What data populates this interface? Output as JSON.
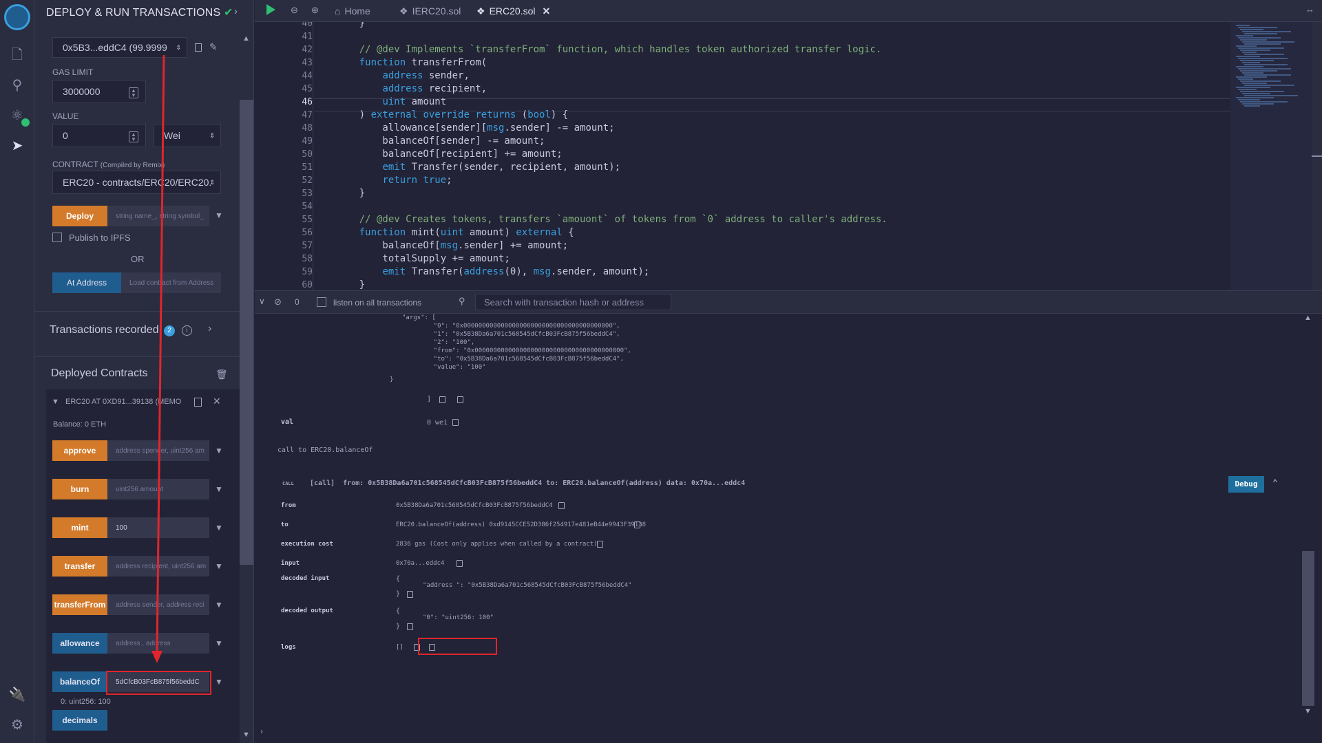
{
  "panel": {
    "title": "DEPLOY & RUN TRANSACTIONS",
    "account": "0x5B3...eddC4 (99.9999",
    "gas_limit_label": "GAS LIMIT",
    "gas_limit": "3000000",
    "value_label": "VALUE",
    "value": "0",
    "value_unit": "Wei",
    "contract_label": "CONTRACT",
    "contract_compiled_note": "(Compiled by Remix)",
    "contract": "ERC20 - contracts/ERC20/ERC20.",
    "deploy_label": "Deploy",
    "deploy_placeholder": "string name_, string symbol_",
    "publish_ipfs": "Publish to IPFS",
    "or": "OR",
    "at_address_label": "At Address",
    "at_address_placeholder": "Load contract from Address",
    "transactions_recorded": "Transactions recorded",
    "transactions_count": "2",
    "deployed_contracts": "Deployed Contracts",
    "instance_title": "ERC20 AT 0XD91...39138 (MEMO",
    "balance": "Balance: 0 ETH",
    "functions": [
      {
        "label": "approve",
        "placeholder": "address spender, uint256 am"
      },
      {
        "label": "burn",
        "placeholder": "uint256 amount"
      },
      {
        "label": "mint",
        "value": "100"
      },
      {
        "label": "transfer",
        "placeholder": "address recipient, uint256 am"
      },
      {
        "label": "transferFrom",
        "placeholder": "address sender, address reci"
      },
      {
        "label": "allowance",
        "placeholder": "address , address"
      },
      {
        "label": "balanceOf",
        "value": "5dCfcB03FcB875f56beddC"
      },
      {
        "label": "decimals"
      }
    ],
    "balanceof_result": "0: uint256: 100"
  },
  "tabs": [
    {
      "label": "Home"
    },
    {
      "label": "IERC20.sol"
    },
    {
      "label": "ERC20.sol"
    }
  ],
  "editor": {
    "lines": [
      {
        "n": "40",
        "text": "    }"
      },
      {
        "n": "41",
        "text": ""
      },
      {
        "n": "42",
        "text": "    // @dev Implements `transferFrom` function, which handles token authorized transfer logic."
      },
      {
        "n": "43",
        "text": "    function transferFrom("
      },
      {
        "n": "44",
        "text": "        address sender,"
      },
      {
        "n": "45",
        "text": "        address recipient,"
      },
      {
        "n": "46",
        "text": "        uint amount"
      },
      {
        "n": "47",
        "text": "    ) external override returns (bool) {"
      },
      {
        "n": "48",
        "text": "        allowance[sender][msg.sender] -= amount;"
      },
      {
        "n": "49",
        "text": "        balanceOf[sender] -= amount;"
      },
      {
        "n": "50",
        "text": "        balanceOf[recipient] += amount;"
      },
      {
        "n": "51",
        "text": "        emit Transfer(sender, recipient, amount);"
      },
      {
        "n": "52",
        "text": "        return true;"
      },
      {
        "n": "53",
        "text": "    }"
      },
      {
        "n": "54",
        "text": ""
      },
      {
        "n": "55",
        "text": "    // @dev Creates tokens, transfers `amouont` of tokens from `0` address to caller's address."
      },
      {
        "n": "56",
        "text": "    function mint(uint amount) external {"
      },
      {
        "n": "57",
        "text": "        balanceOf[msg.sender] += amount;"
      },
      {
        "n": "58",
        "text": "        totalSupply += amount;"
      },
      {
        "n": "59",
        "text": "        emit Transfer(address(0), msg.sender, amount);"
      },
      {
        "n": "60",
        "text": "    }"
      }
    ]
  },
  "terminal": {
    "pending_count": "0",
    "listen_label": "listen on all transactions",
    "search_placeholder": "Search with transaction hash or address",
    "log_top": [
      "\"args\": [",
      "    \"0\": \"0x0000000000000000000000000000000000000000\",",
      "    \"1\": \"0x5B38Da6a701c568545dCfcB03FcB875f56beddC4\",",
      "    \"2\": \"100\",",
      "    \"from\": \"0x0000000000000000000000000000000000000000\",",
      "    \"to\": \"0x5B38Da6a701c568545dCfcB03FcB875f56beddC4\",",
      "    \"value\": \"100\"",
      "}"
    ],
    "val_key": "val",
    "val_value": "0 wei",
    "call_to": "call to ERC20.balanceOf",
    "call_badge": "CALL",
    "call_summary": "[call]  from: 0x5B38Da6a701c568545dCfcB03FcB875f56beddC4 to: ERC20.balanceOf(address) data: 0x70a...eddc4",
    "debug_label": "Debug",
    "rows": [
      {
        "key": "from",
        "value": "0x5B38Da6a701c568545dCfcB03FcB875f56beddC4"
      },
      {
        "key": "to",
        "value": "ERC20.balanceOf(address) 0xd9145CCE52D386f254917e481eB44e9943F39138"
      },
      {
        "key": "execution cost",
        "value": "2836 gas (Cost only applies when called by a contract)"
      },
      {
        "key": "input",
        "value": "0x70a...eddc4"
      },
      {
        "key": "decoded input",
        "value": "\"address \": \"0x5B38Da6a701c568545dCfcB03FcB875f56beddC4\""
      },
      {
        "key": "decoded output",
        "value": "\"0\": \"uint256: 100\""
      },
      {
        "key": "logs",
        "value": "[]"
      }
    ]
  },
  "colors": {
    "bg": "#222336",
    "panel": "#2a2c3f",
    "accent_orange": "#d37b2b",
    "accent_blue": "#1f5d8e",
    "annotation_red": "#e0262c",
    "success_green": "#2fbf71"
  }
}
